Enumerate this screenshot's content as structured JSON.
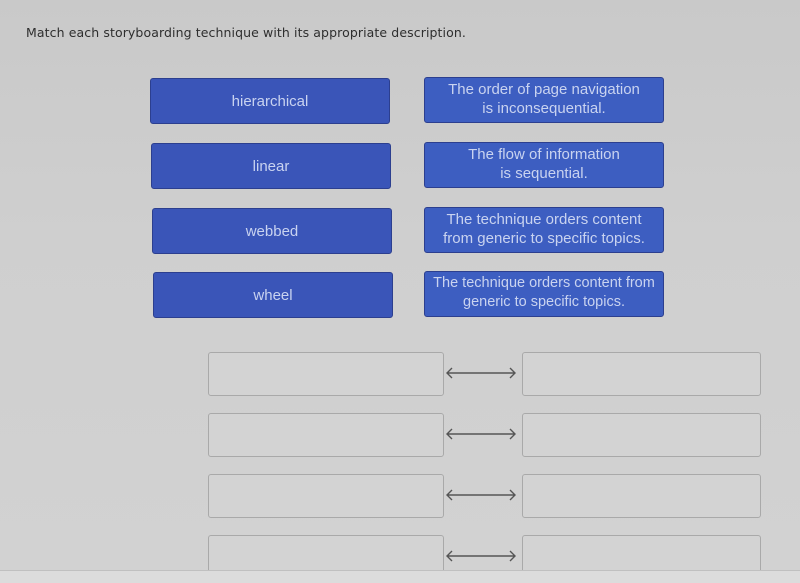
{
  "question": {
    "prompt": "Match each storyboarding technique with its appropriate description."
  },
  "terms": [
    {
      "label": "hierarchical"
    },
    {
      "label": "linear"
    },
    {
      "label": "webbed"
    },
    {
      "label": "wheel"
    }
  ],
  "descriptions": [
    {
      "line1": "The order of page navigation",
      "line2": "is inconsequential."
    },
    {
      "line1": "The flow of information",
      "line2": "is sequential."
    },
    {
      "line1": "The technique orders content",
      "line2": "from generic to specific topics."
    },
    {
      "line1": "The technique orders content from",
      "line2": "generic to specific topics."
    }
  ],
  "match_rows": [
    {
      "left": "",
      "right": "",
      "connector_icon": "double-arrow-icon"
    },
    {
      "left": "",
      "right": "",
      "connector_icon": "double-arrow-icon"
    },
    {
      "left": "",
      "right": "",
      "connector_icon": "double-arrow-icon"
    },
    {
      "left": "",
      "right": "",
      "connector_icon": "double-arrow-icon"
    }
  ],
  "colors": {
    "tile_bg": "#3a55b8",
    "tile_text": "#c9d3f0",
    "page_bg": "#cfcfcf"
  }
}
